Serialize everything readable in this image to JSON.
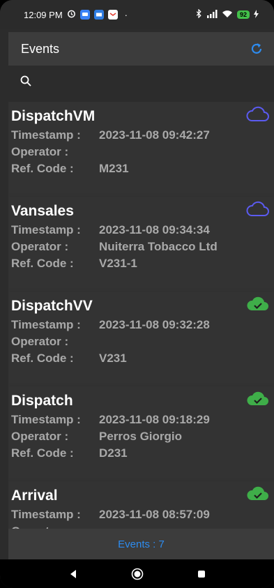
{
  "status": {
    "time": "12:09 PM",
    "battery": "92",
    "icons": [
      "alarm-icon",
      "chat-icon",
      "mail-icon",
      "gmail-icon",
      "bluetooth-icon",
      "signal-icon",
      "wifi-icon",
      "battery-icon"
    ]
  },
  "appbar": {
    "title": "Events",
    "refresh_icon": "refresh-icon"
  },
  "search": {
    "icon": "search-icon"
  },
  "labels": {
    "timestamp": "Timestamp :",
    "operator": "Operator :",
    "ref": "Ref. Code :"
  },
  "events": [
    {
      "title": "DispatchVM",
      "timestamp": "2023-11-08 09:42:27",
      "operator": "",
      "ref": "M231",
      "sync": "cloud-outline-icon"
    },
    {
      "title": "Vansales",
      "timestamp": "2023-11-08 09:34:34",
      "operator": "Nuiterra Tobacco Ltd",
      "ref": "V231-1",
      "sync": "cloud-outline-icon"
    },
    {
      "title": "DispatchVV",
      "timestamp": "2023-11-08 09:32:28",
      "operator": "",
      "ref": "V231",
      "sync": "cloud-check-icon"
    },
    {
      "title": "Dispatch",
      "timestamp": "2023-11-08 09:18:29",
      "operator": "Perros Giorgio",
      "ref": "D231",
      "sync": "cloud-check-icon"
    },
    {
      "title": "Arrival",
      "timestamp": "2023-11-08 08:57:09",
      "operator": "",
      "ref": "",
      "sync": "cloud-check-icon"
    }
  ],
  "footer": {
    "count_label": "Events : 7"
  },
  "colors": {
    "accent": "#2d8cf0",
    "cloud_outline": "#5b5bf0",
    "cloud_synced": "#3fae49"
  }
}
